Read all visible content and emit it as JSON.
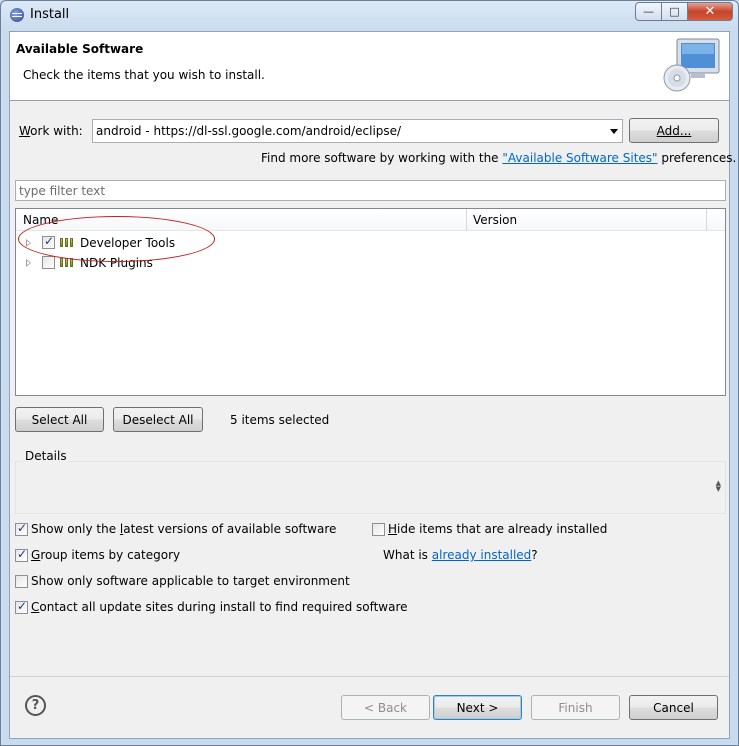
{
  "window": {
    "title": "Install"
  },
  "header": {
    "title": "Available Software",
    "description": "Check the items that you wish to install."
  },
  "work_with": {
    "label_mnemonic": "W",
    "label_rest": "ork with:",
    "value": "android - https://dl-ssl.google.com/android/eclipse/",
    "add_button": "Add..."
  },
  "find_more": {
    "prefix": "Find more software by working with the ",
    "link": "\"Available Software Sites\"",
    "suffix": " preferences."
  },
  "filter": {
    "placeholder": "type filter text"
  },
  "tree": {
    "columns": {
      "name": "Name",
      "version": "Version"
    },
    "items": [
      {
        "label": "Developer Tools",
        "checked": true
      },
      {
        "label": "NDK Plugins",
        "checked": false
      }
    ]
  },
  "selection": {
    "select_all": "Select All",
    "deselect_all": "Deselect All",
    "status": "5 items selected"
  },
  "details": {
    "title": "Details"
  },
  "options": {
    "latest_versions": {
      "pre": "Show only the ",
      "mn": "l",
      "post": "atest versions of available software",
      "checked": true
    },
    "hide_installed": {
      "pre": "",
      "mn": "H",
      "post": "ide items that are already installed",
      "checked": false
    },
    "group_category": {
      "pre": "",
      "mn": "G",
      "post": "roup items by category",
      "checked": true
    },
    "what_is_prefix": "What is ",
    "already_installed_link": "already installed",
    "what_is_suffix": "?",
    "target_env": {
      "pre": "Show only software applicable to target environment",
      "mn": "",
      "post": "",
      "checked": false
    },
    "contact_sites": {
      "pre": "",
      "mn": "C",
      "post": "ontact all update sites during install to find required software",
      "checked": true
    }
  },
  "footer": {
    "help_icon": "?",
    "back": "< Back",
    "next": "Next >",
    "finish": "Finish",
    "cancel": "Cancel"
  },
  "icons": {
    "title": "eclipse-icon",
    "header": "computer-cd-icon",
    "package": "feature-group-icon"
  },
  "colors": {
    "link": "#0066cc",
    "annotation": "#c02020"
  }
}
